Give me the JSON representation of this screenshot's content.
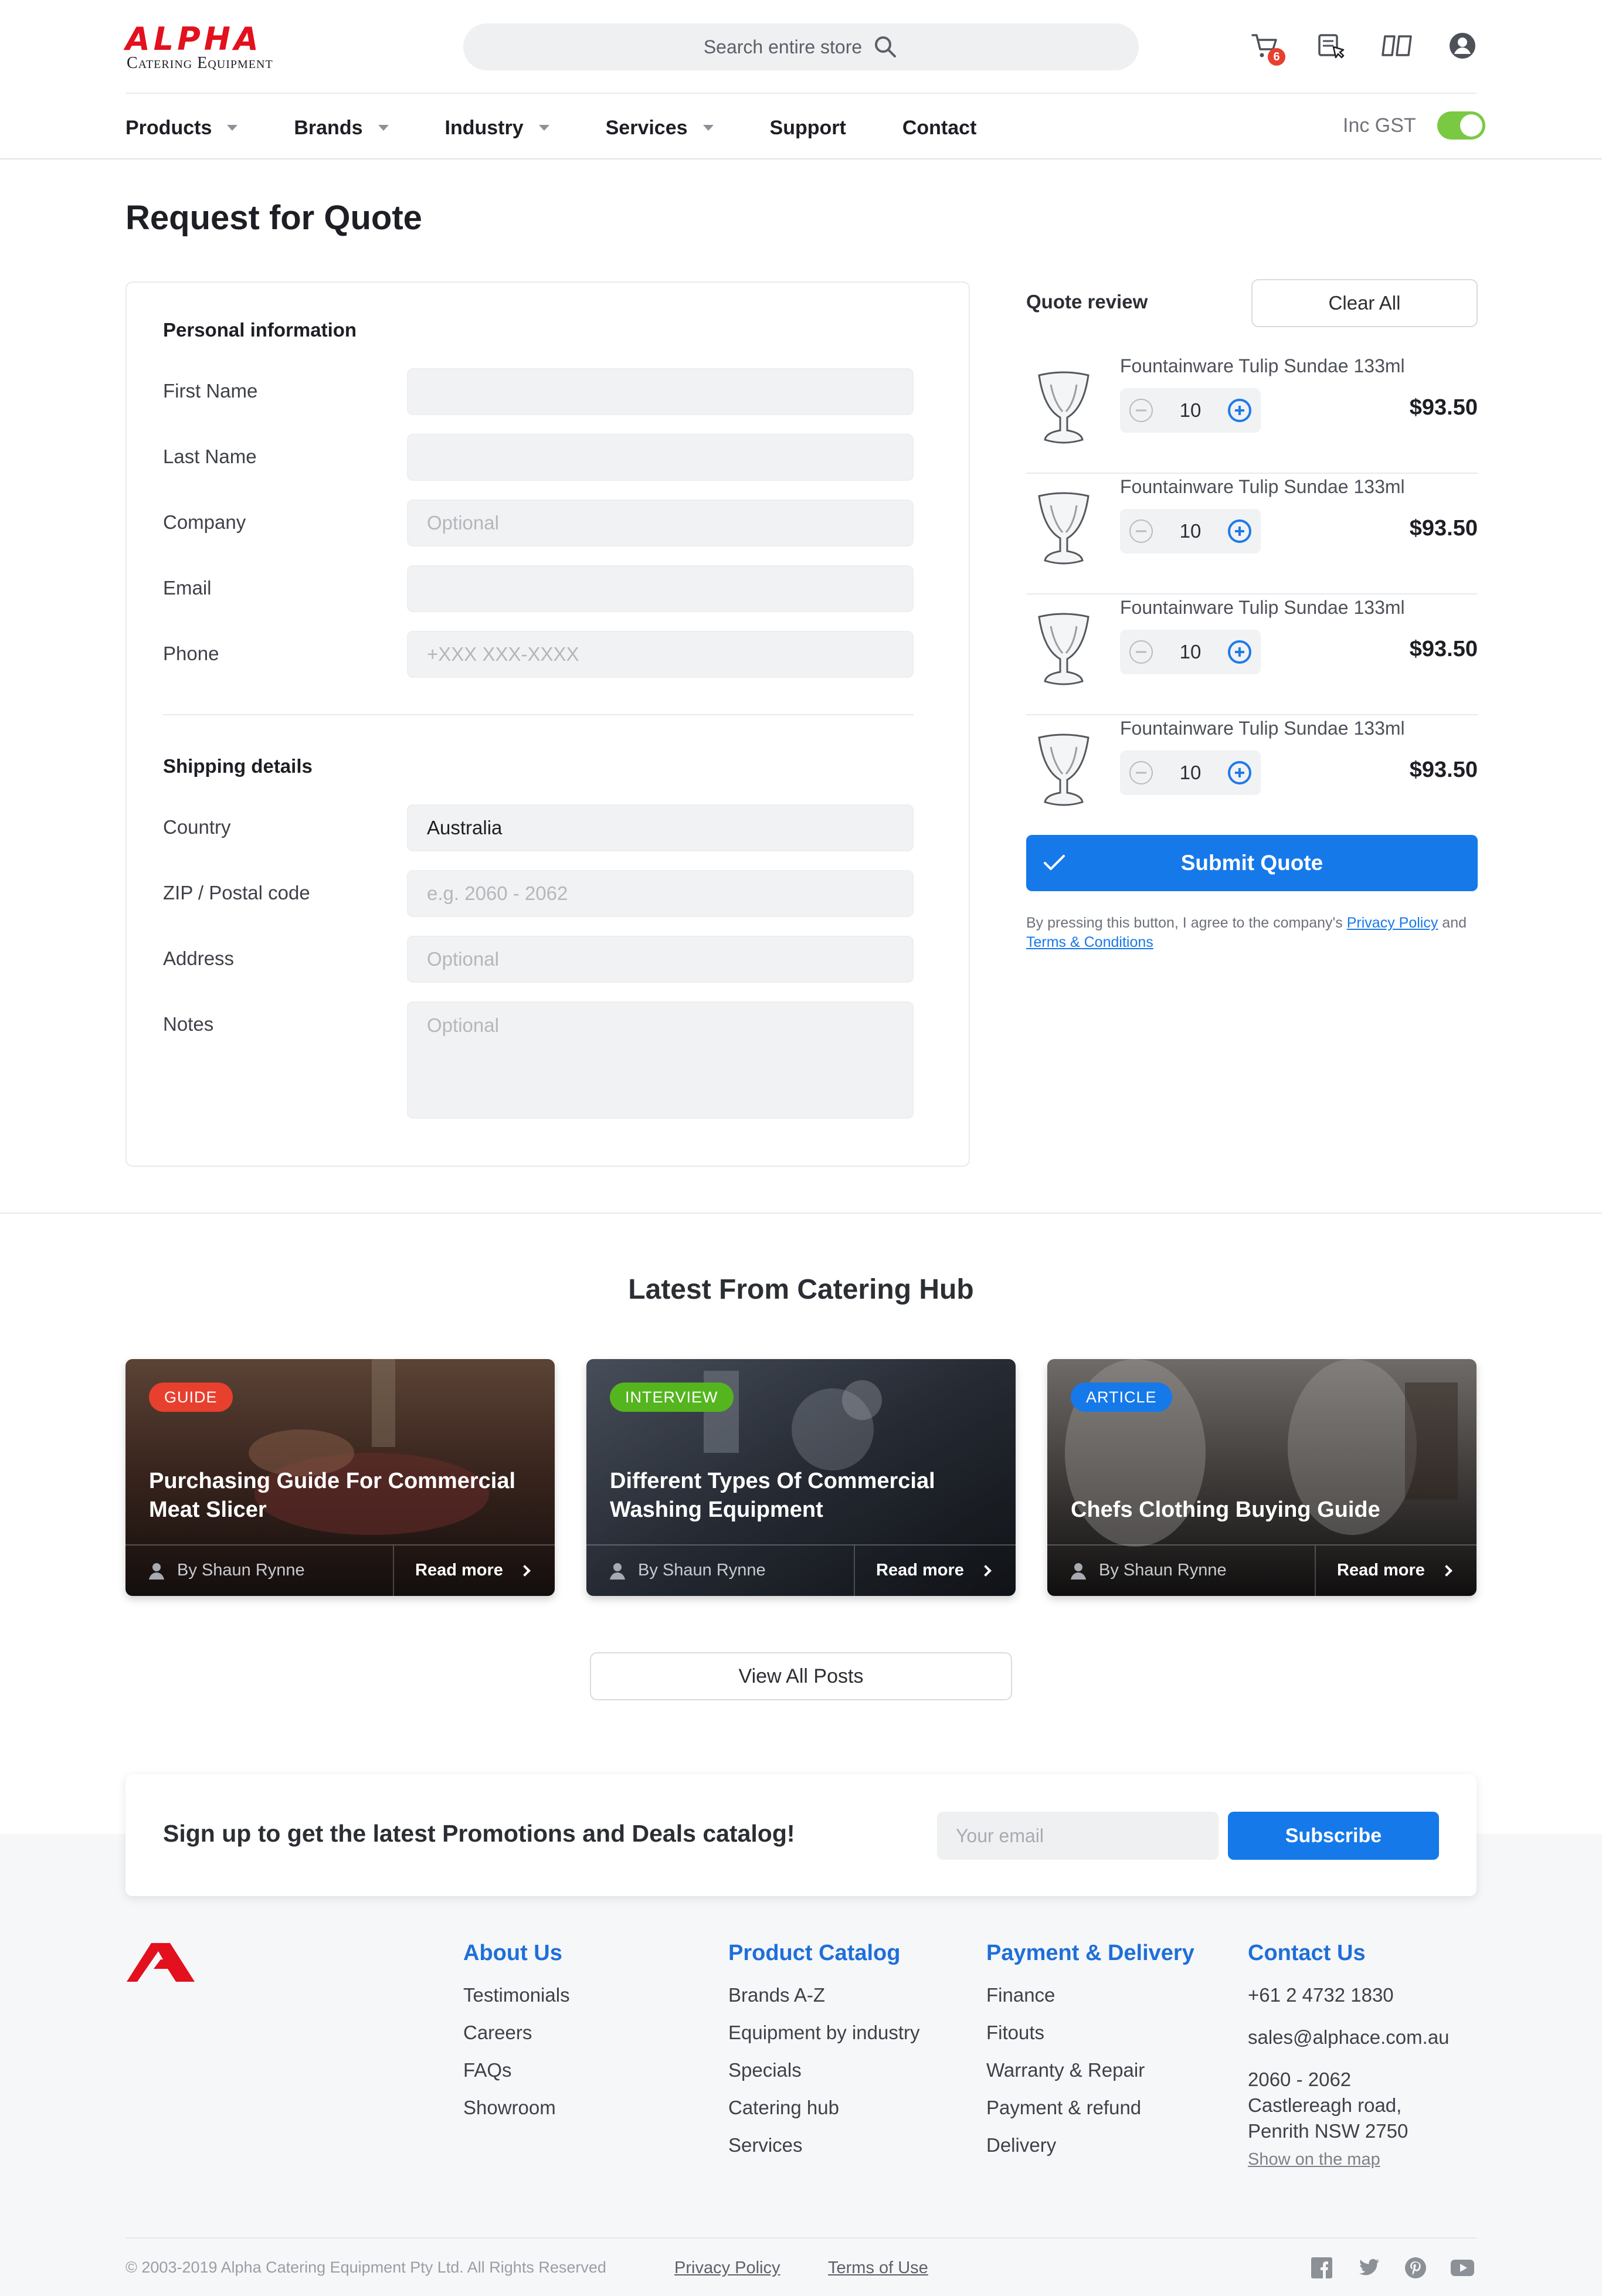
{
  "brand": {
    "name": "ALPHA",
    "subtitle": "Catering Equipment",
    "accent_color": "#e3101d"
  },
  "search": {
    "placeholder": "Search entire store"
  },
  "header_icons": [
    "cart-icon",
    "quote-list-icon",
    "compare-icon",
    "account-icon"
  ],
  "cart": {
    "count": "6"
  },
  "nav": {
    "items": [
      {
        "label": "Products",
        "dropdown": true
      },
      {
        "label": "Brands",
        "dropdown": true
      },
      {
        "label": "Industry",
        "dropdown": true
      },
      {
        "label": "Services",
        "dropdown": true
      },
      {
        "label": "Support",
        "dropdown": false
      },
      {
        "label": "Contact",
        "dropdown": false
      }
    ],
    "gst_label": "Inc GST",
    "gst_on": true,
    "toggle_color": "#7ac943"
  },
  "page": {
    "title": "Request for Quote"
  },
  "form": {
    "personal_heading": "Personal information",
    "personal_fields": [
      {
        "label": "First Name",
        "value": "",
        "placeholder": ""
      },
      {
        "label": "Last Name",
        "value": "",
        "placeholder": ""
      },
      {
        "label": "Company",
        "value": "",
        "placeholder": "Optional"
      },
      {
        "label": "Email",
        "value": "",
        "placeholder": ""
      },
      {
        "label": "Phone",
        "value": "",
        "placeholder": "+XXX XXX-XXXX"
      }
    ],
    "shipping_heading": "Shipping details",
    "shipping_fields": [
      {
        "label": "Country",
        "value": "Australia",
        "placeholder": ""
      },
      {
        "label": "ZIP / Postal code",
        "value": "",
        "placeholder": "e.g. 2060 - 2062"
      },
      {
        "label": "Address",
        "value": "",
        "placeholder": "Optional"
      },
      {
        "label": "Notes",
        "value": "",
        "placeholder": "Optional"
      }
    ]
  },
  "review": {
    "title": "Quote review",
    "clear_label": "Clear All",
    "items": [
      {
        "name": "Fountainware Tulip Sundae 133ml",
        "qty": "10",
        "price": "$93.50"
      },
      {
        "name": "Fountainware Tulip Sundae 133ml",
        "qty": "10",
        "price": "$93.50"
      },
      {
        "name": "Fountainware Tulip Sundae 133ml",
        "qty": "10",
        "price": "$93.50"
      },
      {
        "name": "Fountainware Tulip Sundae 133ml",
        "qty": "10",
        "price": "$93.50"
      }
    ],
    "submit_label": "Submit Quote",
    "consent_prefix": "By pressing this button, I agree to the company's",
    "privacy_label": "Privacy Policy",
    "consent_and": "and",
    "terms_label": "Terms & Conditions",
    "primary_color": "#1679ea"
  },
  "hub": {
    "title": "Latest From Catering Hub",
    "posts": [
      {
        "tag": "GUIDE",
        "tag_color": "#e8402f",
        "title": "Purchasing Guide For Commercial Meat Slicer",
        "author": "By Shaun Rynne",
        "read_more": "Read more"
      },
      {
        "tag": "INTERVIEW",
        "tag_color": "#54b51f",
        "title": "Different Types Of Commercial Washing Equipment",
        "author": "By Shaun Rynne",
        "read_more": "Read more"
      },
      {
        "tag": "ARTICLE",
        "tag_color": "#1679ea",
        "title": "Chefs Clothing Buying Guide",
        "author": "By Shaun Rynne",
        "read_more": "Read more"
      }
    ],
    "view_all": "View All Posts"
  },
  "newsletter": {
    "text": "Sign up to get the latest Promotions and Deals catalog!",
    "placeholder": "Your email",
    "button": "Subscribe"
  },
  "footer": {
    "about": {
      "heading": "About Us",
      "links": [
        "Testimonials",
        "Careers",
        "FAQs",
        "Showroom"
      ]
    },
    "catalog": {
      "heading": "Product Catalog",
      "links": [
        "Brands A-Z",
        "Equipment by industry",
        "Specials",
        "Catering hub",
        "Services"
      ]
    },
    "payment": {
      "heading": "Payment & Delivery",
      "links": [
        "Finance",
        "Fitouts",
        "Warranty & Repair",
        "Payment & refund",
        "Delivery"
      ]
    },
    "contact": {
      "heading": "Contact Us",
      "phone": "+61 2 4732 1830",
      "email": "sales@alphace.com.au",
      "address_line1": "2060 - 2062",
      "address_line2": "Castlereagh road,",
      "address_line3": "Penrith NSW 2750",
      "map_link": "Show on the map"
    },
    "copyright": "© 2003-2019 Alpha Catering Equipment Pty Ltd. All Rights Reserved",
    "privacy": "Privacy Policy",
    "terms": "Terms of Use",
    "social": [
      "facebook-icon",
      "twitter-icon",
      "pinterest-icon",
      "youtube-icon"
    ]
  }
}
